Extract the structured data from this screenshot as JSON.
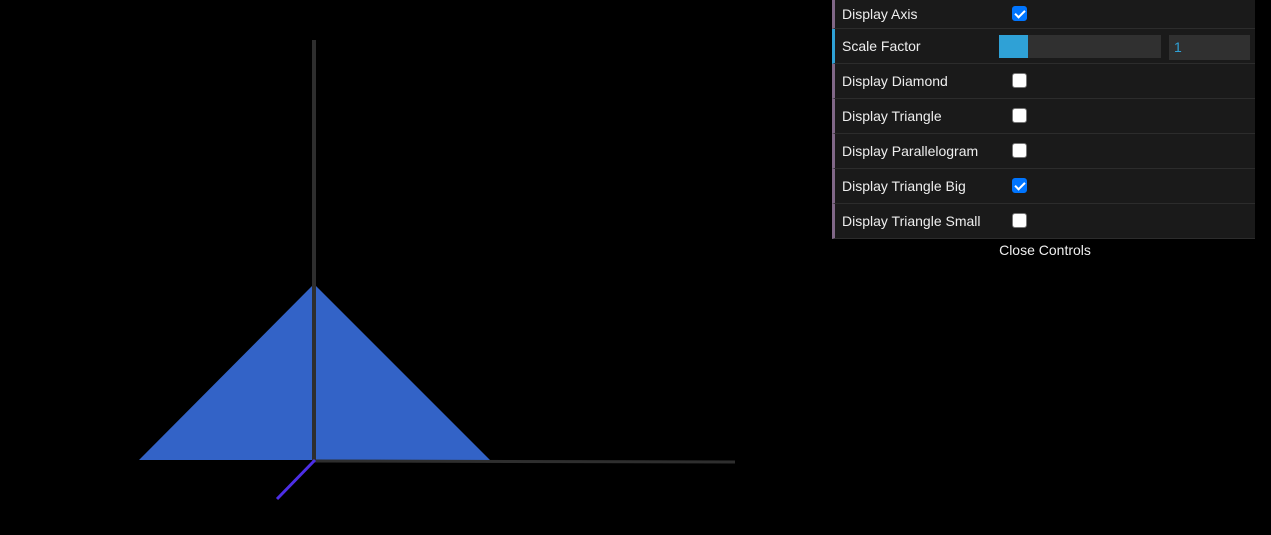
{
  "scene": {
    "background": "#000000",
    "mesh_color": "#3363c7",
    "axis_color": "#2e2e2e",
    "z_axis_color": "#4d2ee6"
  },
  "controls": {
    "items": [
      {
        "label": "Display Axis",
        "type": "checkbox",
        "checked": true
      },
      {
        "label": "Scale Factor",
        "type": "number",
        "value": "1",
        "fill_fraction": 0.18
      },
      {
        "label": "Display Diamond",
        "type": "checkbox",
        "checked": false
      },
      {
        "label": "Display Triangle",
        "type": "checkbox",
        "checked": false
      },
      {
        "label": "Display Parallelogram",
        "type": "checkbox",
        "checked": false
      },
      {
        "label": "Display Triangle Big",
        "type": "checkbox",
        "checked": true
      },
      {
        "label": "Display Triangle Small",
        "type": "checkbox",
        "checked": false
      }
    ],
    "close_label": "Close Controls",
    "colors": {
      "panel_bg": "#1a1a1a",
      "boolean_accent": "#806787",
      "number_accent": "#2fa1d6"
    }
  }
}
